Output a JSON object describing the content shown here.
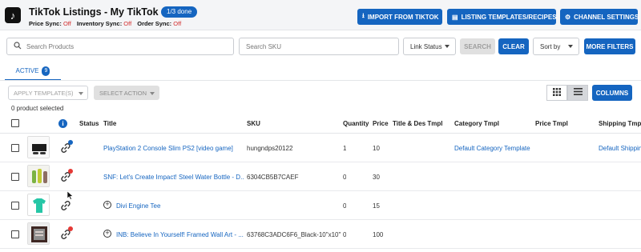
{
  "header": {
    "logo_glyph": "♪",
    "title": "TikTok Listings - My TikTok Shop",
    "progress_badge": "1/3 done",
    "sync": [
      {
        "label": "Price Sync:",
        "value": "Off"
      },
      {
        "label": "Inventory Sync:",
        "value": "Off"
      },
      {
        "label": "Order Sync:",
        "value": "Off"
      }
    ],
    "buttons": [
      {
        "label": "IMPORT FROM TIKTOK",
        "icon": "download-icon"
      },
      {
        "label": "LISTING TEMPLATES/RECIPES",
        "icon": "document-icon"
      },
      {
        "label": "CHANNEL SETTINGS",
        "icon": "gear-icon"
      }
    ]
  },
  "filters": {
    "search_products_placeholder": "Search Products",
    "search_sku_placeholder": "Search SKU",
    "link_status": "Link Status",
    "search_button": "SEARCH",
    "clear_button": "CLEAR",
    "sort_by": "Sort by",
    "more_filters": "MORE FILTERS"
  },
  "tabs": [
    {
      "label": "ACTIVE",
      "count": "9"
    }
  ],
  "actions": {
    "apply_template": "APPLY TEMPLATE(S)",
    "select_action": "SELECT ACTION",
    "columns_button": "COLUMNS",
    "selected_count": "0 product selected"
  },
  "table": {
    "headers": {
      "status": "Status",
      "title": "Title",
      "sku": "SKU",
      "quantity": "Quantity",
      "price": "Price",
      "title_des_tmpl": "Title & Des Tmpl",
      "category_tmpl": "Category Tmpl",
      "price_tmpl": "Price Tmpl",
      "shipping_tmpl": "Shipping Tmpl"
    },
    "rows": [
      {
        "title": "PlayStation 2 Console Slim PS2 [video game]",
        "sku": "hungndps20122",
        "quantity": "1",
        "price": "10",
        "category_tmpl": "Default Category Template",
        "shipping_tmpl": "Default Shipping",
        "status_dot": "#1565c0",
        "has_plus": false,
        "thumb": "console"
      },
      {
        "title": "SNF: Let's Create Impact! Steel Water Bottle - D...",
        "sku": "6304CB5B7CAEF",
        "quantity": "0",
        "price": "30",
        "category_tmpl": "",
        "shipping_tmpl": "",
        "status_dot": "#e53935",
        "has_plus": false,
        "thumb": "bottles"
      },
      {
        "title": "Divi Engine Tee",
        "sku": "",
        "quantity": "0",
        "price": "15",
        "category_tmpl": "",
        "shipping_tmpl": "",
        "status_dot": "",
        "has_plus": true,
        "thumb": "tee"
      },
      {
        "title": "INB: Believe In Yourself! Framed Wall Art - ...",
        "sku": "63768C3ADC6F6_Black-10\"x10\"",
        "quantity": "0",
        "price": "100",
        "category_tmpl": "",
        "shipping_tmpl": "",
        "status_dot": "#e53935",
        "has_plus": true,
        "thumb": "frame"
      }
    ]
  },
  "colors": {
    "accent": "#1565c0",
    "off": "#d32f2f",
    "error_dot": "#e53935"
  }
}
